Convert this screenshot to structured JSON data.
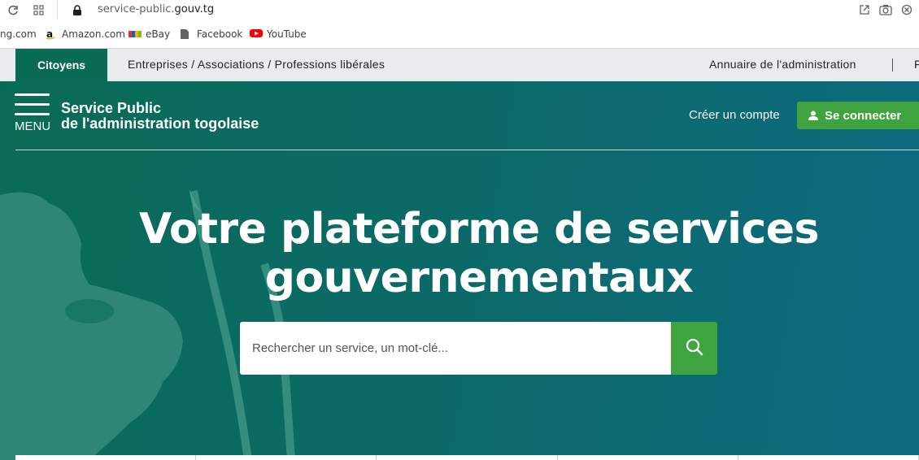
{
  "browser": {
    "url_prefix": "service-public.",
    "url_domain": "gouv.tg",
    "bookmarks": [
      {
        "label": "ng.com"
      },
      {
        "label": "Amazon.com"
      },
      {
        "label": "eBay"
      },
      {
        "label": "Facebook"
      },
      {
        "label": "YouTube"
      }
    ]
  },
  "topnav": {
    "active_tab": "Citoyens",
    "other_tab": "Entreprises / Associations / Professions libérales",
    "annuaire": "Annuaire de l'administration",
    "trailing": "F"
  },
  "header": {
    "menu_label": "MENU",
    "brand_line1": "Service Public",
    "brand_line2": "de l'administration togolaise",
    "create_account": "Créer un compte",
    "login": "Se connecter"
  },
  "hero": {
    "title_line1": "Votre plateforme de services",
    "title_line2": "gouvernementaux"
  },
  "search": {
    "placeholder": "Rechercher un service, un mot-clé..."
  },
  "colors": {
    "primary_green": "#0a6b55",
    "button_green": "#3fa33f",
    "hero_end": "#0d6a80"
  }
}
